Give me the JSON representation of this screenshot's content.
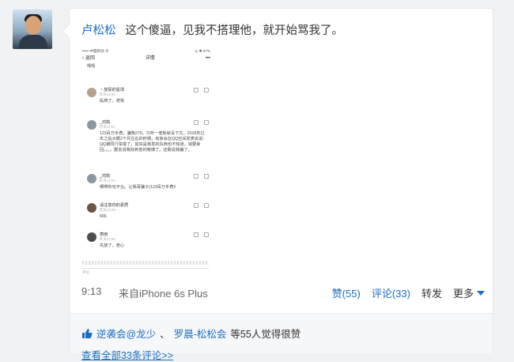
{
  "post": {
    "author": "卢松松",
    "text": "这个傻逼，见我不搭理他，就开始骂我了。"
  },
  "screenshot": {
    "status_left": "••••• 中国移动 令",
    "status_right": "◎ ✱ 97%",
    "back_label": "返回",
    "nav_title": "详情",
    "nav_more": "•••",
    "top_text": "嘻嘻",
    "comments": [
      {
        "name": "丶放屁的星球",
        "time": "昨天13:34",
        "text": "乱牌了。老铁"
      },
      {
        "name": "_鸿鹄",
        "time": "昨天14:02",
        "text": "123百万手表。骗我279。只听一老板就没下文。2016年过年之后大概2个月左右的时候。有家会在QQ空间发表说说：QQ被同行举报了。其实是我发的东西也不知道。钱要拿回。。。。群友说我找到他的微博了，还敢说我骗了。"
      },
      {
        "name": "_鸿鹄",
        "time": "昨天17:04",
        "text": "哪啊你也平台。让我哥骗子(123百万手表)!"
      },
      {
        "name": "请注意你的素质",
        "time": "昨天13:48",
        "text": "666"
      },
      {
        "name": "萧雨",
        "time": "昨天17:00",
        "text": "先放了，老心"
      }
    ],
    "input_placeholder": "评论"
  },
  "meta": {
    "time": "9:13",
    "source": "来自iPhone 6s Plus"
  },
  "actions": {
    "like": "赞(55)",
    "comment": "评论(33)",
    "repost": "转发",
    "more": "更多"
  },
  "likes": {
    "prefix_user": "逆袭会@龙少",
    "separator": "、",
    "second_user": "罗晨-松松会",
    "suffix": "等55人觉得很赞"
  },
  "view_all": "查看全部33条评论>>",
  "colors": {
    "link": "#1b6fc2",
    "background": "#f1f2f4"
  }
}
